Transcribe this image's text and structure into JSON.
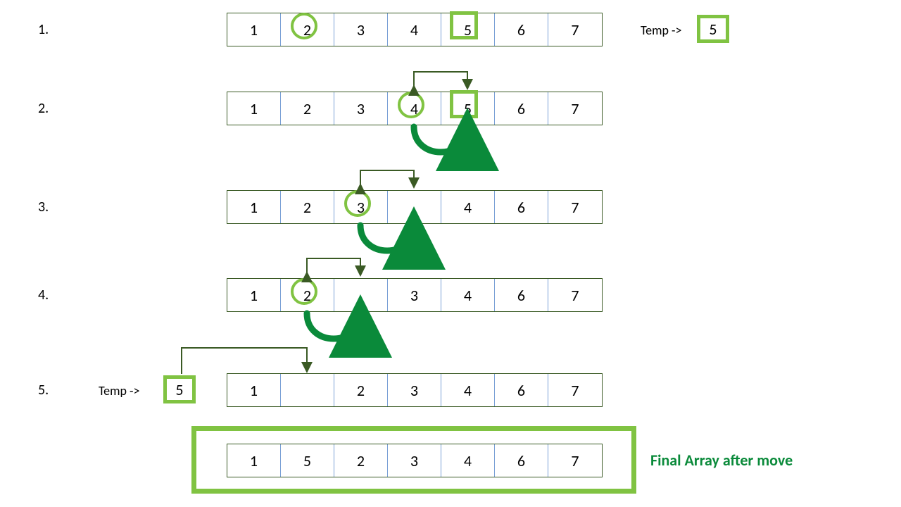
{
  "layout": {
    "arrayLeft": 322,
    "cellW": 76,
    "cellH": 46,
    "rowY": [
      18,
      130,
      270,
      395,
      530,
      630
    ],
    "labelX": 54
  },
  "steps": [
    {
      "label": "1.",
      "cells": [
        "1",
        "2",
        "3",
        "4",
        "5",
        "6",
        "7"
      ],
      "circleIdx": 1,
      "squareIdx": 4
    },
    {
      "label": "2.",
      "cells": [
        "1",
        "2",
        "3",
        "4",
        "5",
        "6",
        "7"
      ],
      "circleIdx": 3,
      "squareIdx": 4
    },
    {
      "label": "3.",
      "cells": [
        "1",
        "2",
        "3",
        "",
        "4",
        "6",
        "7"
      ],
      "circleIdx": 2
    },
    {
      "label": "4.",
      "cells": [
        "1",
        "2",
        "",
        "3",
        "4",
        "6",
        "7"
      ],
      "circleIdx": 1
    },
    {
      "label": "5.",
      "cells": [
        "1",
        "",
        "2",
        "3",
        "4",
        "6",
        "7"
      ]
    }
  ],
  "final": {
    "cells": [
      "1",
      "5",
      "2",
      "3",
      "4",
      "6",
      "7"
    ],
    "label": "Final Array after move"
  },
  "temp": {
    "label": "Temp ->",
    "value": "5"
  },
  "colors": {
    "lightGreen": "#80c342",
    "darkGreen": "#3a5a24",
    "arrowGreen": "#0a8a3a",
    "cellDivider": "#7aa0d6"
  },
  "brackets": [
    {
      "row": 1,
      "fromIdx": 3,
      "toIdx": 4,
      "above": true
    },
    {
      "row": 2,
      "fromIdx": 2,
      "toIdx": 3,
      "above": true
    },
    {
      "row": 3,
      "fromIdx": 1,
      "toIdx": 2,
      "above": true
    }
  ],
  "curvedArrows": [
    {
      "row": 1,
      "fromIdx": 3,
      "toIdx": 4
    },
    {
      "row": 2,
      "fromIdx": 2,
      "toIdx": 3
    },
    {
      "row": 3,
      "fromIdx": 1,
      "toIdx": 2
    }
  ],
  "tempToCellBracket": {
    "fromX": 258,
    "toIdx": 1,
    "row": 4
  }
}
